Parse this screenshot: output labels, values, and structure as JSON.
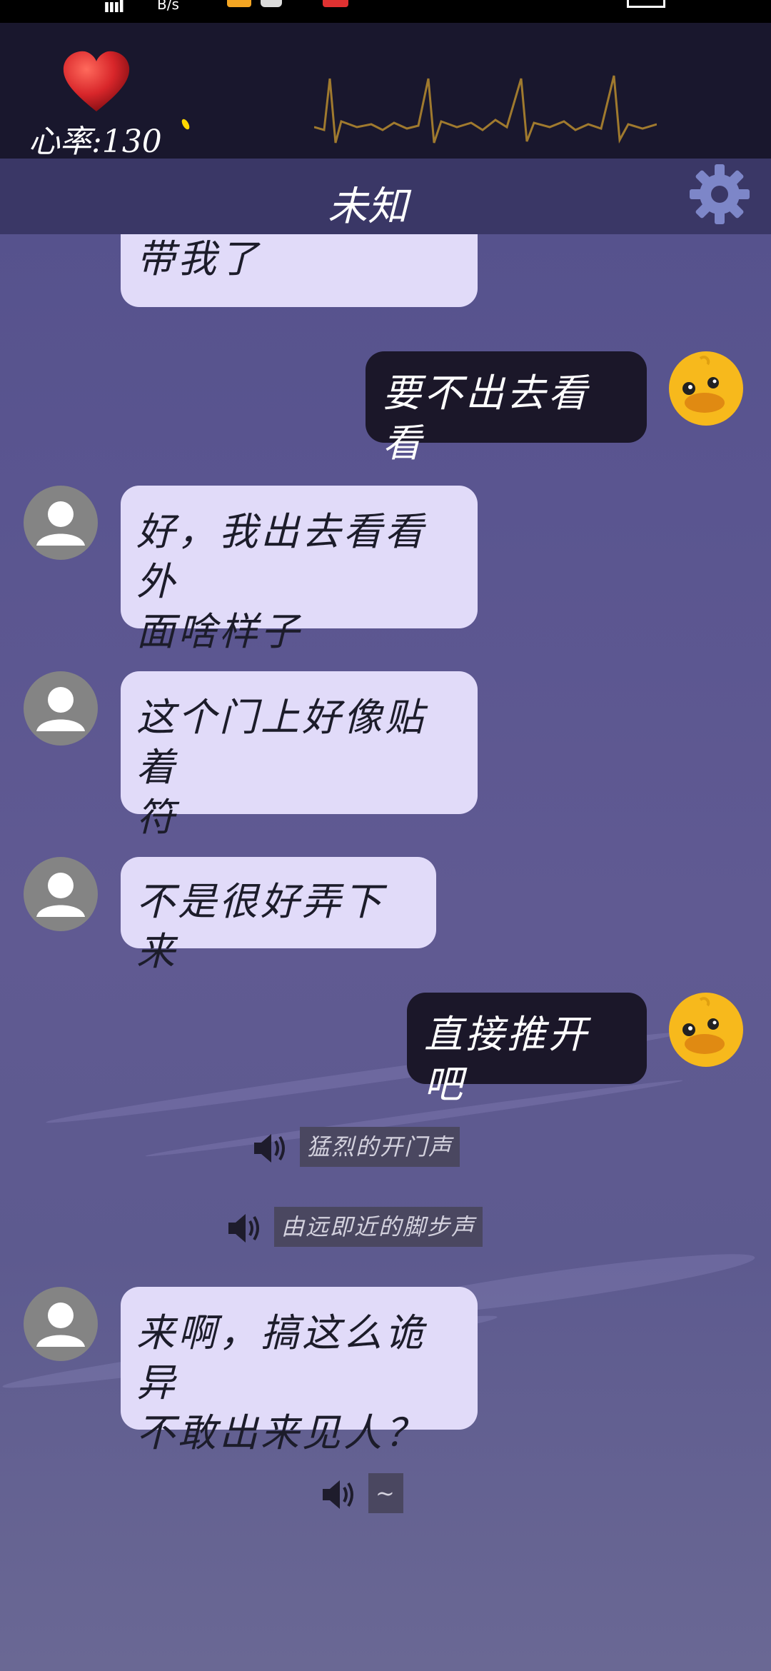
{
  "header": {
    "heart_rate": "心率:130",
    "title": "未知"
  },
  "messages": [
    {
      "id": "m0",
      "side": "left",
      "text": "带我了"
    },
    {
      "id": "m1",
      "side": "right",
      "text": "要不出去看看"
    },
    {
      "id": "m2",
      "side": "left",
      "lines": [
        "好，我出去看看外",
        "面啥样子"
      ]
    },
    {
      "id": "m3",
      "side": "left",
      "lines": [
        "这个门上好像贴着",
        "符"
      ]
    },
    {
      "id": "m4",
      "side": "left",
      "text": "不是很好弄下来"
    },
    {
      "id": "m5",
      "side": "right",
      "text": "直接推开吧"
    },
    {
      "id": "m6",
      "side": "left",
      "lines": [
        "来啊，搞这么诡异",
        "不敢出来见人？"
      ]
    }
  ],
  "sound_effects": [
    "猛烈的开门声",
    "由远即近的脚步声",
    "~"
  ],
  "colors": {
    "header_bg": "#19172d",
    "titlebar_bg": "#3a3766",
    "incoming_bubble": "#e1dbf9",
    "outgoing_bubble": "#1b1729",
    "ecg_line": "#a07a2e",
    "gear": "#7d86c8"
  }
}
